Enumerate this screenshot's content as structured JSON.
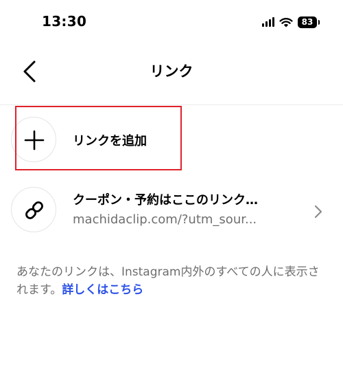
{
  "status_bar": {
    "time": "13:30",
    "battery": "83",
    "icons": [
      "signal-icon",
      "wifi-icon",
      "battery-icon"
    ]
  },
  "header": {
    "title": "リンク",
    "back_icon": "chevron-left-icon"
  },
  "add_link": {
    "label": "リンクを追加",
    "icon": "plus-icon",
    "highlight_color": "#e0202a"
  },
  "links": [
    {
      "title": "クーポン・予約はここのリンク…",
      "url": "machidaclip.com/?utm_sour...",
      "icon": "link-icon"
    }
  ],
  "info": {
    "text": "あなたのリンクは、Instagram内外のすべての人に表示されます。",
    "link_label": "詳しくはこちら",
    "link_color": "#2c52e8"
  }
}
